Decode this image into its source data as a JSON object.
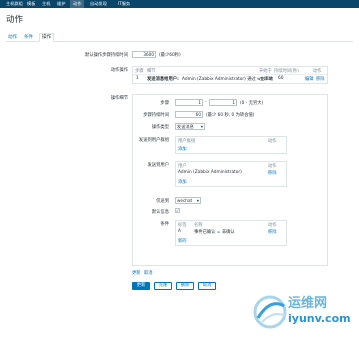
{
  "topnav": {
    "items": [
      "主机群组",
      "模板",
      "主机",
      "维护",
      "动作",
      "自动发现",
      "IT服务"
    ],
    "active_index": 4
  },
  "page": {
    "title": "动作"
  },
  "tabs": [
    "动作",
    "条件",
    "操作"
  ],
  "form": {
    "default_step_duration_label": "默认操作步骤持续时间",
    "default_step_duration_value": "3600",
    "default_step_duration_hint": "(最少60秒)",
    "action_ops": {
      "label": "动作操作",
      "headers": [
        "步骤",
        "细节",
        "开始于",
        "持续时间(秒)",
        "动作"
      ],
      "row": {
        "step": "1",
        "detail_prefix": "发送消息给用户:",
        "detail_text": " Admin (Zabbix Administrator) 通过 wechat",
        "start": "立即地",
        "duration": "60",
        "edit": "编辑",
        "remove": "移除"
      }
    },
    "op_details": {
      "label": "操作细节",
      "steps_label": "步骤",
      "steps_from": "1",
      "steps_to": "1",
      "steps_hint": "(0 - 无穷大)",
      "step_duration_label": "步骤持续时间",
      "step_duration_value": "60",
      "step_duration_hint": "(最少 60 秒, 0 为转会值)",
      "op_type_label": "操作类型",
      "op_type_value": "发送消息",
      "send_groups_label": "发送到用户群组",
      "send_groups_col1": "用户群组",
      "send_groups_col2": "动作",
      "send_groups_add": "添加",
      "send_users_label": "发送到用户",
      "send_users_col1": "用户",
      "send_users_col2": "动作",
      "send_users_user": "Admin (Zabbix Administrator)",
      "send_users_remove": "移除",
      "send_users_add": "添加",
      "send_only_label": "仅送到",
      "send_only_value": "wechat",
      "default_msg_label": "默认信息",
      "conditions_label": "条件",
      "cond_col1": "标签",
      "cond_col2": "名称",
      "cond_col3": "动作",
      "cond_tag": "A",
      "cond_name": "事件已确认 = 非确认",
      "cond_remove": "移除",
      "cond_new": "新的"
    },
    "update_link": "更新",
    "cancel_link": "取消"
  },
  "buttons": {
    "update": "更新",
    "clone": "克隆",
    "delete": "删除",
    "cancel": "取消"
  },
  "watermark": {
    "cn": "运维网",
    "en": "iyunv.com"
  }
}
